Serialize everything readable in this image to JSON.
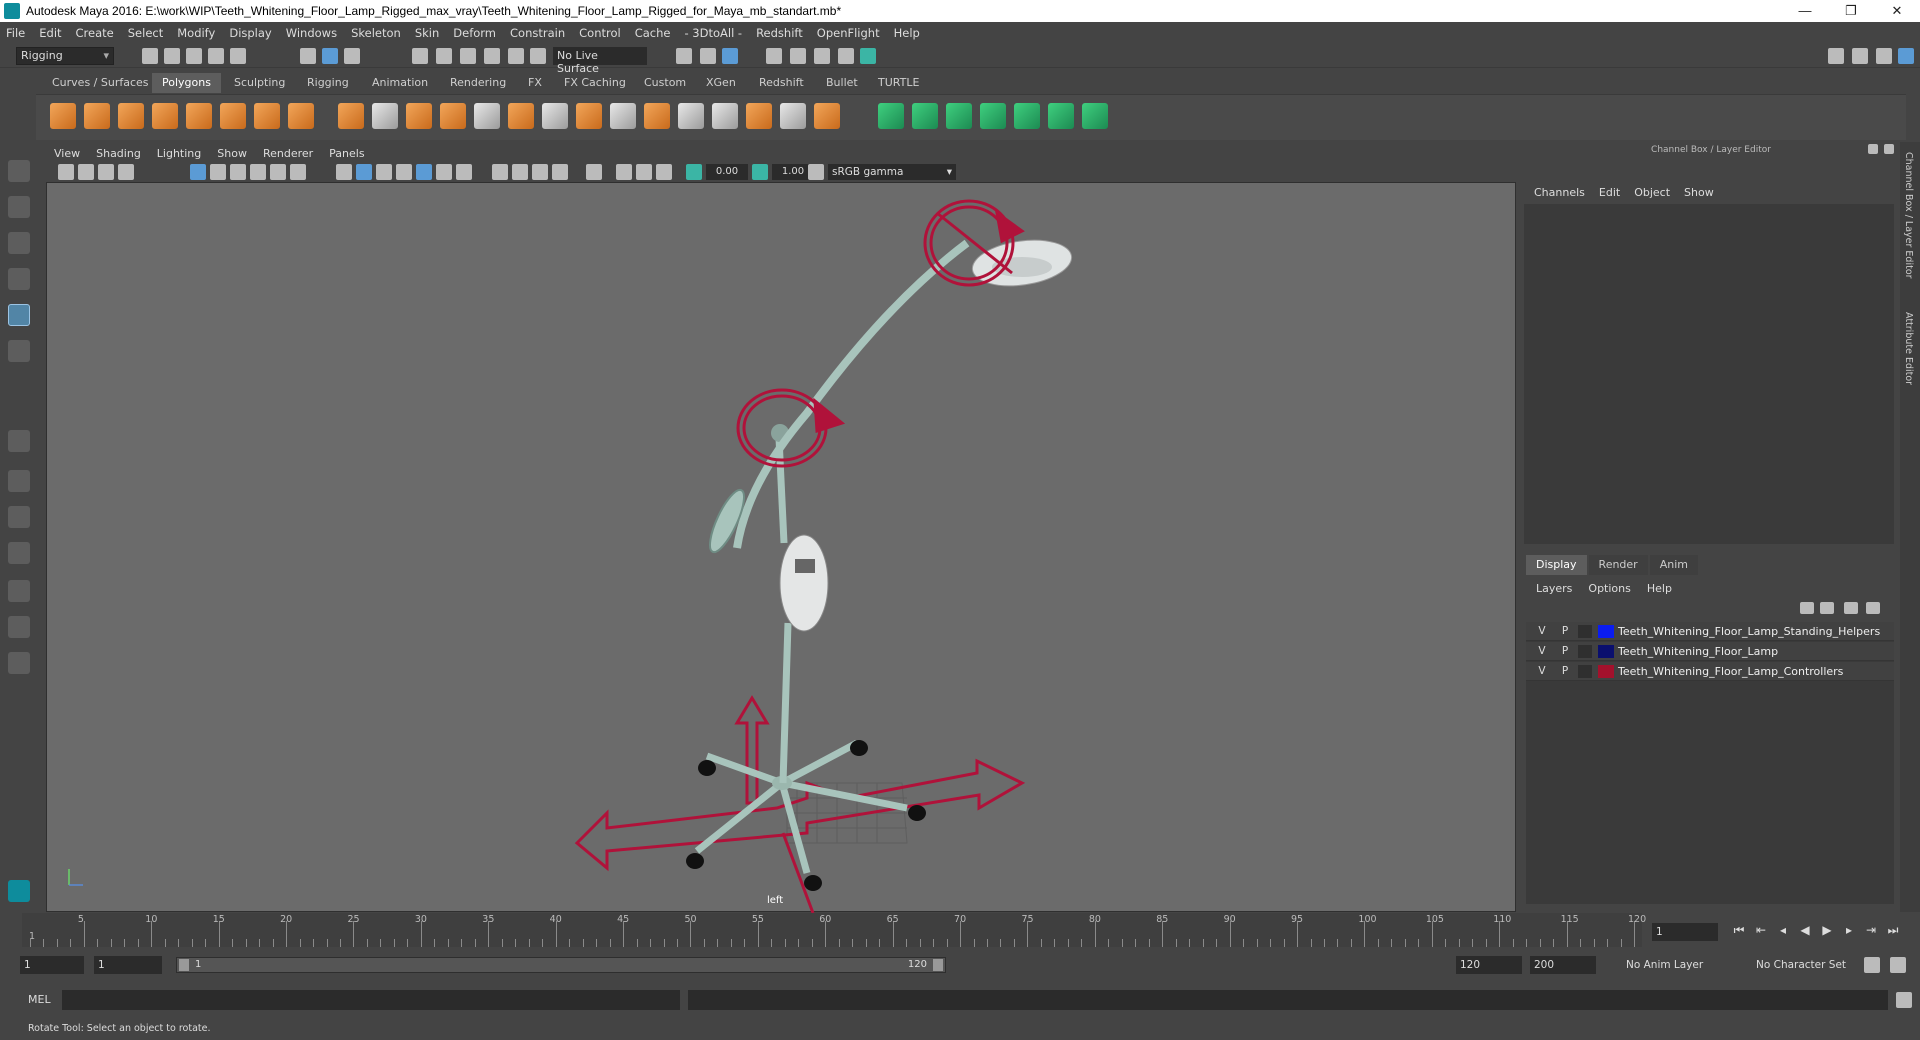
{
  "window": {
    "title": "Autodesk Maya 2016: E:\\work\\WIP\\Teeth_Whitening_Floor_Lamp_Rigged_max_vray\\Teeth_Whitening_Floor_Lamp_Rigged_for_Maya_mb_standart.mb*"
  },
  "menubar": [
    "File",
    "Edit",
    "Create",
    "Select",
    "Modify",
    "Display",
    "Windows",
    "Skeleton",
    "Skin",
    "Deform",
    "Constrain",
    "Control",
    "Cache",
    "- 3DtoAll -",
    "Redshift",
    "OpenFlight",
    "Help"
  ],
  "status": {
    "mode": "Rigging",
    "live_surface": "No Live Surface"
  },
  "shelf_tabs": [
    "Curves / Surfaces",
    "Polygons",
    "Sculpting",
    "Rigging",
    "Animation",
    "Rendering",
    "FX",
    "FX Caching",
    "Custom",
    "XGen",
    "Redshift",
    "Bullet",
    "TURTLE"
  ],
  "shelf_active": "Polygons",
  "panel_menu": [
    "View",
    "Shading",
    "Lighting",
    "Show",
    "Renderer",
    "Panels"
  ],
  "panel_tools": {
    "exposure": "0.00",
    "gamma": "1.00",
    "color_space": "sRGB gamma"
  },
  "viewport": {
    "camera_label": "left"
  },
  "channel_box": {
    "title": "Channel Box / Layer Editor",
    "menu": [
      "Channels",
      "Edit",
      "Object",
      "Show"
    ]
  },
  "layer_editor": {
    "tabs": [
      "Display",
      "Render",
      "Anim"
    ],
    "menu": [
      "Layers",
      "Options",
      "Help"
    ],
    "layers": [
      {
        "v": "V",
        "p": "P",
        "name": "Teeth_Whitening_Floor_Lamp_Standing_Helpers",
        "color": "#0a1cf0"
      },
      {
        "v": "V",
        "p": "P",
        "name": "Teeth_Whitening_Floor_Lamp",
        "color": "#0a0f6e"
      },
      {
        "v": "V",
        "p": "P",
        "name": "Teeth_Whitening_Floor_Lamp_Controllers",
        "color": "#a3112c"
      }
    ]
  },
  "side_tabs": [
    "Channel Box / Layer Editor",
    "Attribute Editor"
  ],
  "timeline": {
    "current_frame": "1",
    "ticks": [
      "5",
      "10",
      "15",
      "20",
      "25",
      "30",
      "35",
      "40",
      "45",
      "50",
      "55",
      "60",
      "65",
      "70",
      "75",
      "80",
      "85",
      "90",
      "95",
      "100",
      "105",
      "110",
      "115",
      "120"
    ],
    "start_marker": "1"
  },
  "range": {
    "start": "1",
    "range_start": "1",
    "slider_start": "1",
    "slider_end": "120",
    "range_end": "120",
    "end": "200",
    "anim_layer": "No Anim Layer",
    "character_set": "No Character Set"
  },
  "mel": {
    "label": "MEL"
  },
  "help_line": "Rotate Tool: Select an object to rotate."
}
